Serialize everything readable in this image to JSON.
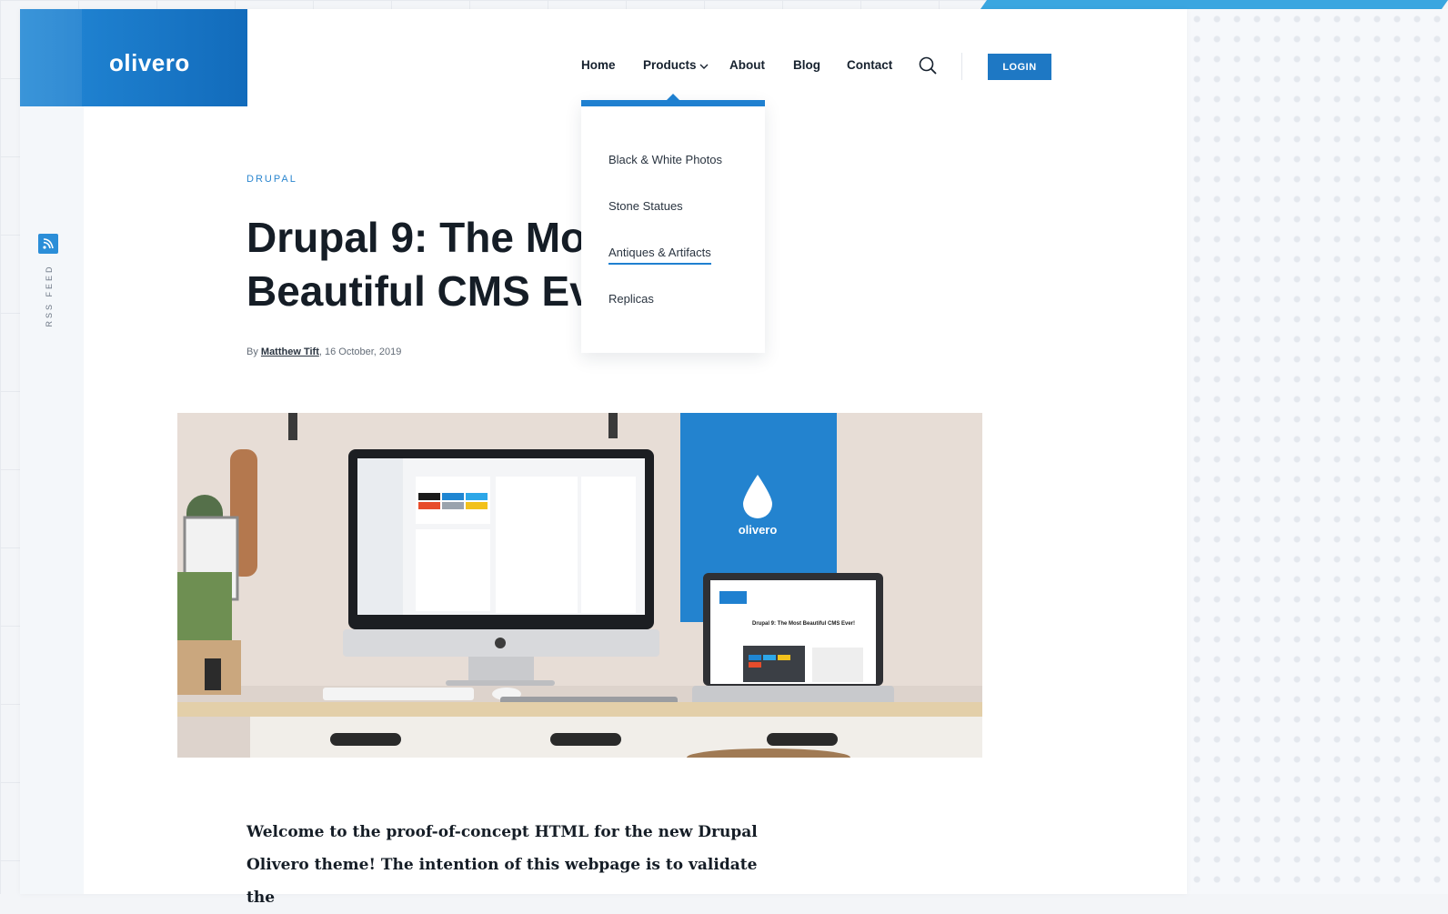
{
  "brand": {
    "logo_text": "olivero",
    "color": "#1f80d0"
  },
  "rss": {
    "label": "RSS FEED",
    "icon": "rss-icon"
  },
  "nav": {
    "items": [
      {
        "label": "Home"
      },
      {
        "label": "Products"
      },
      {
        "label": "About"
      },
      {
        "label": "Blog"
      },
      {
        "label": "Contact"
      }
    ],
    "search_icon": "search-icon",
    "login_label": "LOGIN"
  },
  "dropdown": {
    "items": [
      {
        "label": "Black & White Photos"
      },
      {
        "label": "Stone Statues"
      },
      {
        "label": "Antiques & Artifacts",
        "active": true
      },
      {
        "label": "Replicas"
      }
    ]
  },
  "article": {
    "category": "DRUPAL",
    "title_line1": "Drupal 9: The Most",
    "title_line2": "Beautiful CMS Ever!",
    "by_prefix": "By ",
    "author": "Matthew Tift",
    "date": ", 16 October, 2019",
    "hero_brand": "olivero",
    "hero_laptop_title": "Drupal 9: The Most Beautiful CMS Ever!",
    "intro": "Welcome to the proof-of-concept HTML for the new Drupal Olivero theme! The intention of this webpage is to validate the"
  }
}
